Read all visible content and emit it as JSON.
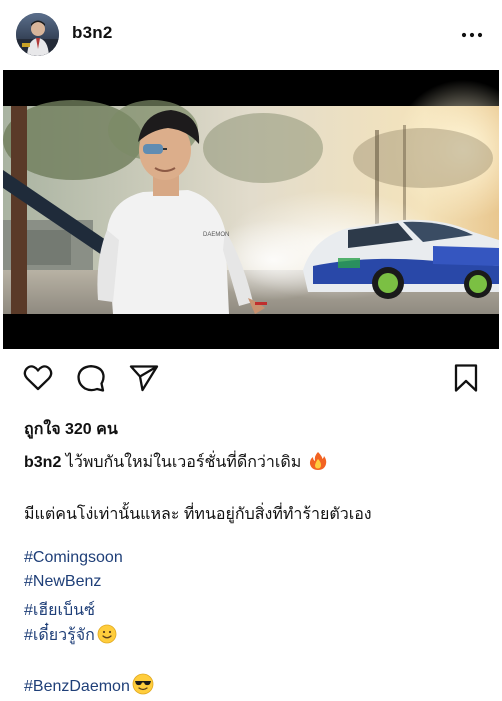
{
  "post": {
    "username": "b3n2",
    "likes_text": "ถูกใจ 320 คน",
    "caption_user": "b3n2",
    "caption_text": "ไว้พบกันใหม่ในเวอร์ชั่นที่ดีกว่าเดิม",
    "caption_line2": "มีแต่คนโง่เท่านั้นแหละ ที่ทนอยู่กับสิ่งที่ทำร้ายตัวเอง",
    "hashtags": [
      "#Comingsoon",
      "#NewBenz",
      "#เฮียเบ็นซ์",
      "#เดี๋ยวรู้จัก",
      "#BenzDaemon"
    ],
    "shirt_print": "DAEMON"
  },
  "icons": {
    "more": "more-horizontal-icon",
    "like": "heart-icon",
    "comment": "comment-icon",
    "share": "send-icon",
    "save": "bookmark-icon",
    "fire": "fire-emoji",
    "smile": "smile-emoji",
    "cool": "sunglasses-emoji"
  },
  "colors": {
    "hashtag": "#1f3f78",
    "text": "#111111",
    "background": "#ffffff"
  }
}
